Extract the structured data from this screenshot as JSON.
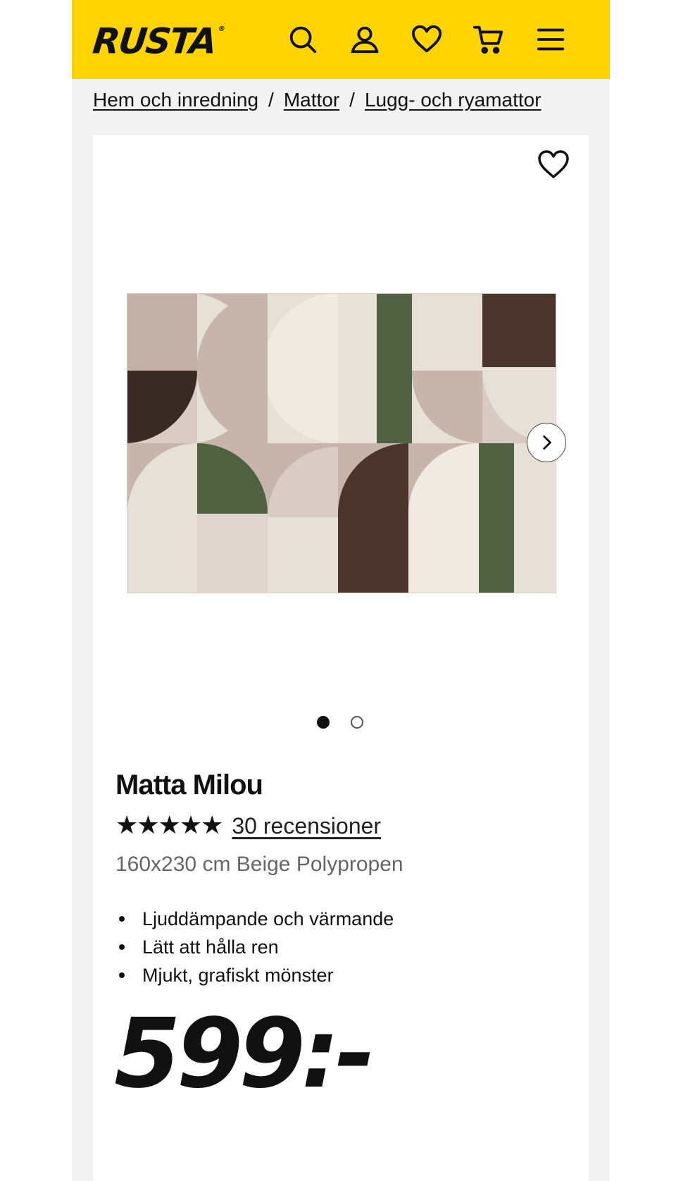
{
  "header": {
    "logo_text": "RUSTA",
    "logo_mark": "®",
    "brand_color": "#ffd400",
    "icons": [
      "search-icon",
      "account-icon",
      "heart-icon",
      "cart-icon",
      "menu-icon"
    ]
  },
  "breadcrumb": {
    "items": [
      "Hem och inredning",
      "Mattor",
      "Lugg- och ryamattor"
    ],
    "separator": "/"
  },
  "gallery": {
    "image_alt": "Matta Milou",
    "image_count": 2,
    "active_index": 0
  },
  "product": {
    "name": "Matta Milou",
    "stars": "★★★★★",
    "rating": 5,
    "reviews_label": "30 recensioner",
    "variant": "160x230 cm Beige Polypropen",
    "features": [
      "Ljuddämpande och värmande",
      "Lätt att hålla ren",
      "Mjukt, grafiskt mönster"
    ],
    "price": "599:-"
  }
}
